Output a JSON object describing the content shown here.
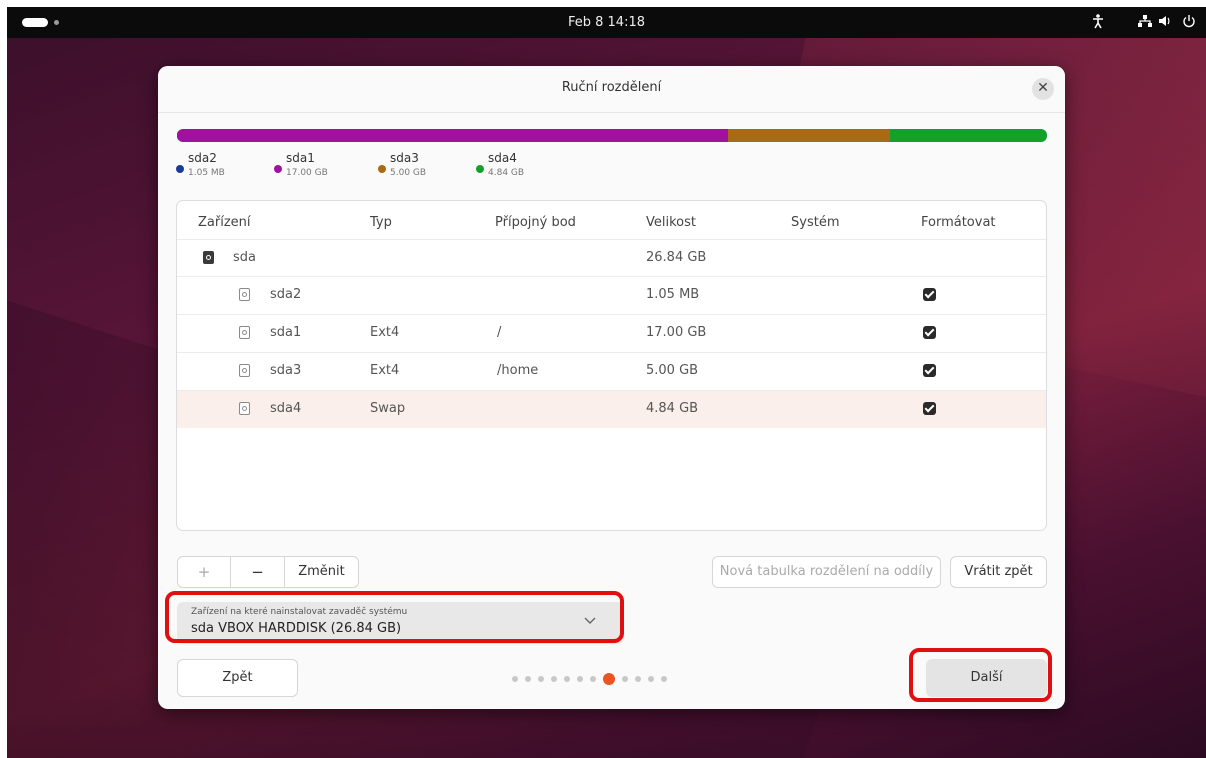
{
  "topbar": {
    "clock": "Feb 8 14:18"
  },
  "dialog": {
    "title": "Ruční rozdělení",
    "close_icon": "close-icon",
    "usage_bar": [
      {
        "name": "sda2",
        "fraction": 0.0001,
        "color": "#2233aa"
      },
      {
        "name": "sda1",
        "fraction": 0.6334,
        "color": "#a0129e"
      },
      {
        "name": "sda3",
        "fraction": 0.1863,
        "color": "#a86a14"
      },
      {
        "name": "sda4",
        "fraction": 0.1803,
        "color": "#14a02a"
      }
    ],
    "legend": [
      {
        "name": "sda2",
        "size": "1.05 MB",
        "color": "#1a3a9a"
      },
      {
        "name": "sda1",
        "size": "17.00 GB",
        "color": "#a0129e"
      },
      {
        "name": "sda3",
        "size": "5.00 GB",
        "color": "#a86a14"
      },
      {
        "name": "sda4",
        "size": "4.84 GB",
        "color": "#14a02a"
      }
    ],
    "table": {
      "headers": {
        "device": "Zařízení",
        "type": "Typ",
        "mount": "Přípojný bod",
        "size": "Velikost",
        "system": "Systém",
        "format": "Formátovat"
      },
      "rows": [
        {
          "device": "sda",
          "type": "",
          "mount": "",
          "size": "26.84 GB",
          "format": null,
          "icon": "disk-icon"
        },
        {
          "device": "sda2",
          "type": "",
          "mount": "",
          "size": "1.05 MB",
          "format": true,
          "icon": "partition-icon"
        },
        {
          "device": "sda1",
          "type": "Ext4",
          "mount": "/",
          "size": "17.00 GB",
          "format": true,
          "icon": "partition-icon"
        },
        {
          "device": "sda3",
          "type": "Ext4",
          "mount": "/home",
          "size": "5.00 GB",
          "format": true,
          "icon": "partition-icon"
        },
        {
          "device": "sda4",
          "type": "Swap",
          "mount": "",
          "size": "4.84 GB",
          "format": true,
          "icon": "partition-icon",
          "selected": true
        }
      ]
    },
    "buttons": {
      "add": "+",
      "remove": "−",
      "change": "Změnit",
      "new_table": "Nová tabulka rozdělení na oddíly",
      "revert": "Vrátit zpět",
      "back": "Zpět",
      "next": "Další"
    },
    "bootloader": {
      "label": "Zařízení na které nainstalovat zavaděč systému",
      "value": "sda VBOX HARDDISK (26.84 GB)"
    },
    "pager": {
      "total": 12,
      "current": 8,
      "accent": "#e95420"
    }
  }
}
